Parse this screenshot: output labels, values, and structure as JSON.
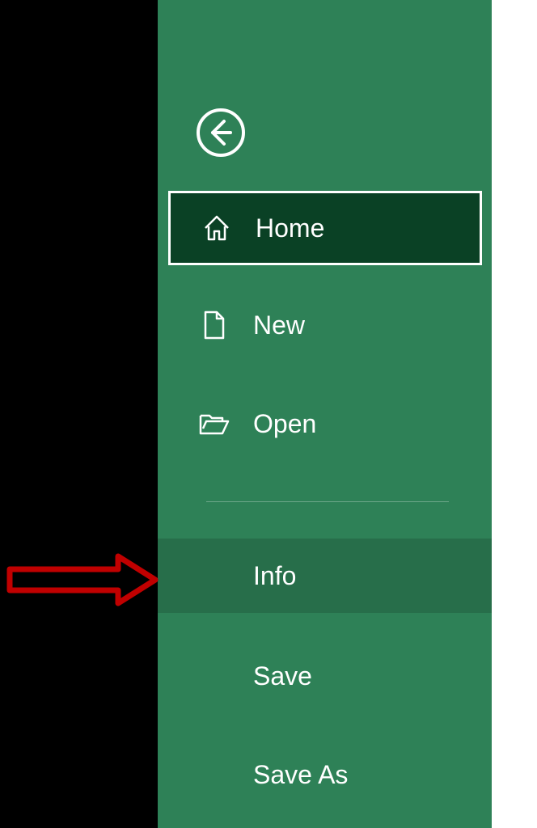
{
  "sidebar": {
    "items": [
      {
        "label": "Home",
        "icon": "home"
      },
      {
        "label": "New",
        "icon": "file"
      },
      {
        "label": "Open",
        "icon": "folder"
      },
      {
        "label": "Info",
        "icon": null
      },
      {
        "label": "Save",
        "icon": null
      },
      {
        "label": "Save As",
        "icon": null
      }
    ]
  },
  "colors": {
    "sidebar_bg": "#2e8157",
    "selected_bg": "#0a4125",
    "highlighted_bg": "#276e4a",
    "annotation_arrow": "#c00000"
  }
}
